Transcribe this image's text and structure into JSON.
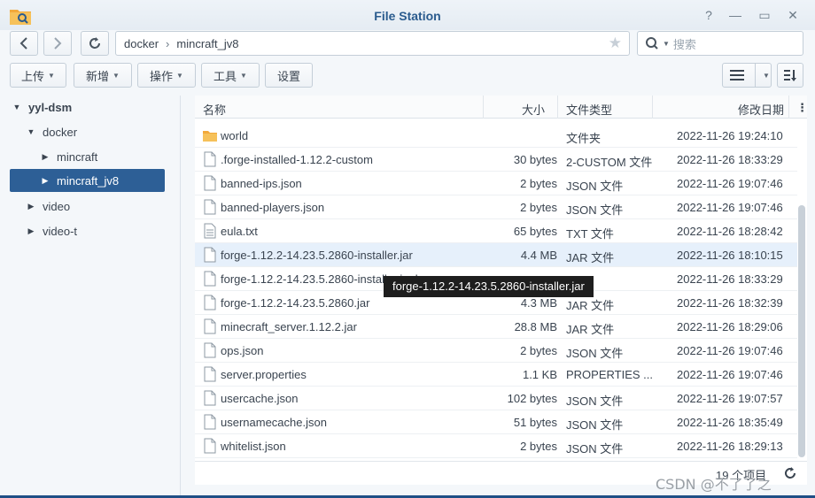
{
  "window": {
    "title": "File Station"
  },
  "nav": {
    "path": [
      "docker",
      "mincraft_jv8"
    ],
    "search_placeholder": "搜索"
  },
  "toolbar": {
    "upload": "上传",
    "create": "新增",
    "action": "操作",
    "tools": "工具",
    "settings": "设置"
  },
  "sidebar": {
    "items": [
      {
        "label": "yyl-dsm"
      },
      {
        "label": "docker"
      },
      {
        "label": "mincraft"
      },
      {
        "label": "mincraft_jv8"
      },
      {
        "label": "video"
      },
      {
        "label": "video-t"
      }
    ]
  },
  "columns": {
    "name": "名称",
    "size": "大小",
    "type": "文件类型",
    "modified": "修改日期"
  },
  "files": [
    {
      "name": "world",
      "size": "",
      "type": "文件夹",
      "modified": "2022-11-26 19:24:10",
      "kind": "folder"
    },
    {
      "name": ".forge-installed-1.12.2-custom",
      "size": "30 bytes",
      "type": "2-CUSTOM 文件",
      "modified": "2022-11-26 18:33:29",
      "kind": "file"
    },
    {
      "name": "banned-ips.json",
      "size": "2 bytes",
      "type": "JSON 文件",
      "modified": "2022-11-26 19:07:46",
      "kind": "file"
    },
    {
      "name": "banned-players.json",
      "size": "2 bytes",
      "type": "JSON 文件",
      "modified": "2022-11-26 19:07:46",
      "kind": "file"
    },
    {
      "name": "eula.txt",
      "size": "65 bytes",
      "type": "TXT 文件",
      "modified": "2022-11-26 18:28:42",
      "kind": "text"
    },
    {
      "name": "forge-1.12.2-14.23.5.2860-installer.jar",
      "size": "4.4 MB",
      "type": "JAR 文件",
      "modified": "2022-11-26 18:10:15",
      "kind": "file"
    },
    {
      "name": "forge-1.12.2-14.23.5.2860-installer.jar.log",
      "size": "",
      "type": "",
      "modified": "2022-11-26 18:33:29",
      "kind": "file"
    },
    {
      "name": "forge-1.12.2-14.23.5.2860.jar",
      "size": "4.3 MB",
      "type": "JAR 文件",
      "modified": "2022-11-26 18:32:39",
      "kind": "file"
    },
    {
      "name": "minecraft_server.1.12.2.jar",
      "size": "28.8 MB",
      "type": "JAR 文件",
      "modified": "2022-11-26 18:29:06",
      "kind": "file"
    },
    {
      "name": "ops.json",
      "size": "2 bytes",
      "type": "JSON 文件",
      "modified": "2022-11-26 19:07:46",
      "kind": "file"
    },
    {
      "name": "server.properties",
      "size": "1.1 KB",
      "type": "PROPERTIES ...",
      "modified": "2022-11-26 19:07:46",
      "kind": "file"
    },
    {
      "name": "usercache.json",
      "size": "102 bytes",
      "type": "JSON 文件",
      "modified": "2022-11-26 19:07:57",
      "kind": "file"
    },
    {
      "name": "usernamecache.json",
      "size": "51 bytes",
      "type": "JSON 文件",
      "modified": "2022-11-26 18:35:49",
      "kind": "file"
    },
    {
      "name": "whitelist.json",
      "size": "2 bytes",
      "type": "JSON 文件",
      "modified": "2022-11-26 18:29:13",
      "kind": "file"
    }
  ],
  "tooltip": "forge-1.12.2-14.23.5.2860-installer.jar",
  "footer": {
    "count": "19 个项目"
  },
  "watermark": "CSDN @不了了之"
}
